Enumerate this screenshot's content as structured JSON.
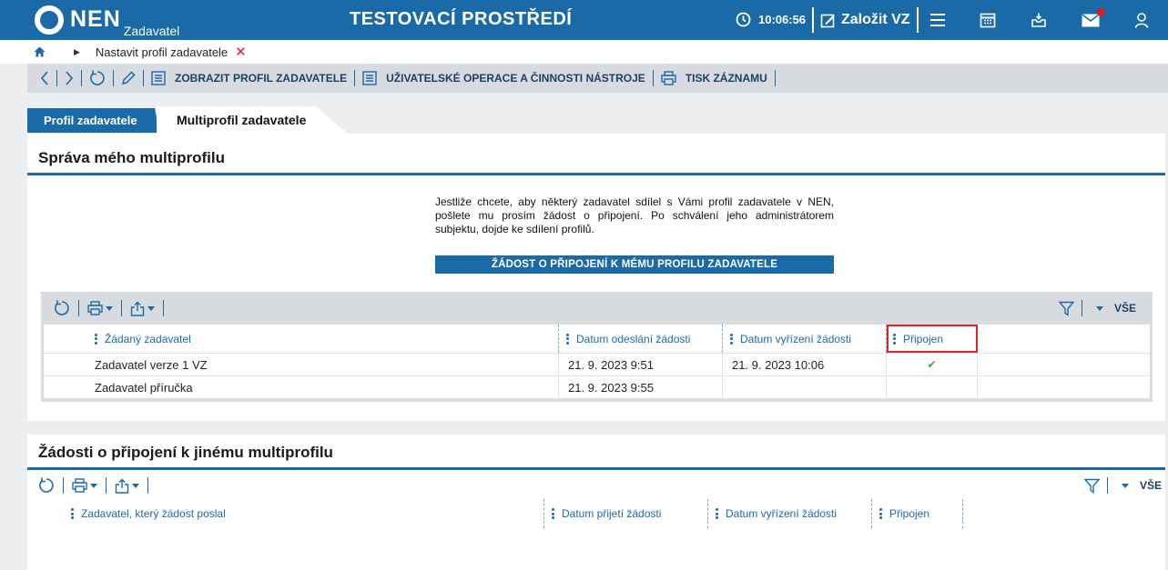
{
  "header": {
    "logo_text": "NEN",
    "logo_sub": "Zadavatel",
    "environment": "TESTOVACÍ PROSTŘEDÍ",
    "time": "10:06:56",
    "create_label": "Založit VZ",
    "icons": [
      "clock-icon",
      "edit-icon",
      "menu-icon",
      "calendar-icon",
      "inbox-icon",
      "mail-icon",
      "user-icon"
    ],
    "brand_color": "#1b6aa8",
    "notification_color": "#e21b23"
  },
  "breadcrumb": {
    "label": "Nastavit profil zadavatele"
  },
  "toolbar": {
    "show_profile": "ZOBRAZIT PROFIL ZADAVATELE",
    "user_ops": "UŽIVATELSKÉ OPERACE A ČINNOSTI NÁSTROJE",
    "print": "TISK ZÁZNAMU"
  },
  "tabs": [
    {
      "label": "Profil zadavatele",
      "active": true
    },
    {
      "label": "Multiprofil zadavatele",
      "active": false
    }
  ],
  "section1": {
    "title": "Správa mého multiprofilu",
    "info": "Jestliže chcete, aby některý zadavatel sdílel s Vámi profil zadavatele v NEN, pošlete mu prosím žádost o připojení. Po schválení jeho administrátorem subjektu, dojde ke sdílení profilů.",
    "request_button": "ŽÁDOST O PŘIPOJENÍ K MÉMU PROFILU ZADAVATELE",
    "filter_label": "VŠE",
    "columns": [
      "Žádaný zadavatel",
      "Datum odeslání žádosti",
      "Datum vyřízení žádosti",
      "Připojen"
    ],
    "rows": [
      {
        "name": "Zadavatel verze 1 VZ",
        "sent": "21. 9. 2023 9:51",
        "resolved": "21. 9. 2023 10:06",
        "connected": "✔"
      },
      {
        "name": "Zadavatel příručka",
        "sent": "21. 9. 2023 9:55",
        "resolved": "",
        "connected": ""
      }
    ],
    "check_color": "#3aa63a",
    "highlight_color": "#e02424"
  },
  "section2": {
    "title": "Žádosti o připojení k jinému multiprofilu",
    "filter_label": "VŠE",
    "columns": [
      "Zadavatel, který žádost poslal",
      "Datum přijetí žádosti",
      "Datum vyřízení žádosti",
      "Připojen"
    ]
  }
}
